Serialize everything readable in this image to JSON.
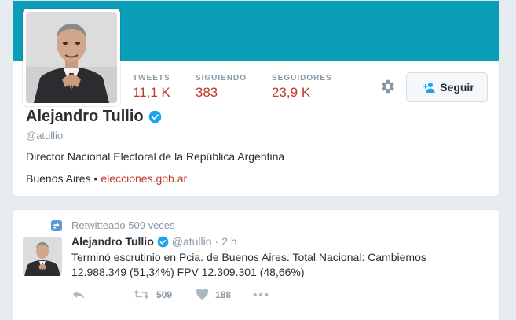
{
  "profile": {
    "name": "Alejandro Tullio",
    "handle": "@atullio",
    "bio": "Director Nacional Electoral de la República Argentina",
    "location": "Buenos Aires",
    "separator": "•",
    "website": "elecciones.gob.ar",
    "banner_color": "#0a9eb8",
    "stats": [
      {
        "label": "TWEETS",
        "value": "11,1 K"
      },
      {
        "label": "SIGUIENDO",
        "value": "383"
      },
      {
        "label": "SEGUIDORES",
        "value": "23,9 K"
      }
    ],
    "settings_icon": "gear-icon",
    "follow_label": "Seguir",
    "verified_icon": "verified-badge-icon"
  },
  "tweet": {
    "retweet_context": "Retwitteado 509 veces",
    "author_name": "Alejandro Tullio",
    "author_handle": "@atullio",
    "separator": "·",
    "time": "2 h",
    "text": "Terminó escrutinio en Pcia. de Buenos Aires. Total Nacional: Cambiemos 12.988.349 (51,34%) FPV 12.309.301 (48,66%)",
    "retweets": "509",
    "likes": "188"
  },
  "colors": {
    "accent": "#c0392b",
    "muted": "#8899a6",
    "verified": "#1da1f2"
  }
}
